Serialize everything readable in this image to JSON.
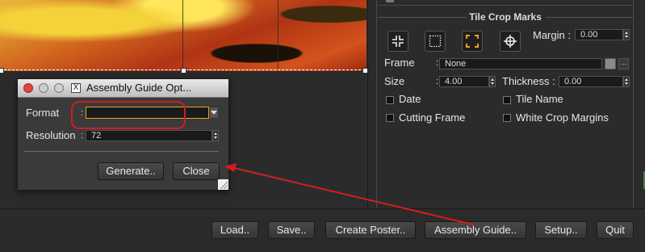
{
  "tile_crop_marks": {
    "title": "Tile Crop Marks",
    "icons": [
      "crop-marks-inward-icon",
      "frame-dotted-icon",
      "corner-brackets-icon",
      "crosshair-icon"
    ],
    "margin_label": "Margin :",
    "margin_value": "0.00",
    "frame_label": "Frame",
    "frame_sep": ":",
    "frame_value": "None",
    "frame_more": "...",
    "size_label": "Size",
    "size_sep": ":",
    "size_value": "4.00",
    "thickness_label": "Thickness :",
    "thickness_value": "0.00",
    "checkboxes": {
      "date": "Date",
      "tile_name": "Tile Name",
      "cutting_frame": "Cutting Frame",
      "white_crop_margins": "White Crop Margins"
    }
  },
  "toolbar": {
    "load": "Load..",
    "save": "Save..",
    "create_poster": "Create Poster..",
    "assembly_guide": "Assembly Guide..",
    "setup": "Setup..",
    "quit": "Quit"
  },
  "dialog": {
    "title": "Assembly Guide Opt...",
    "format_label": "Format",
    "format_sep": ":",
    "format_value": "",
    "resolution_label": "Resolution",
    "resolution_sep": ":",
    "resolution_value": "72",
    "generate": "Generate..",
    "close": "Close"
  },
  "colors": {
    "annotation": "#d21e1e",
    "selected_icon": "#f0a020",
    "background": "#2b2b2b"
  }
}
